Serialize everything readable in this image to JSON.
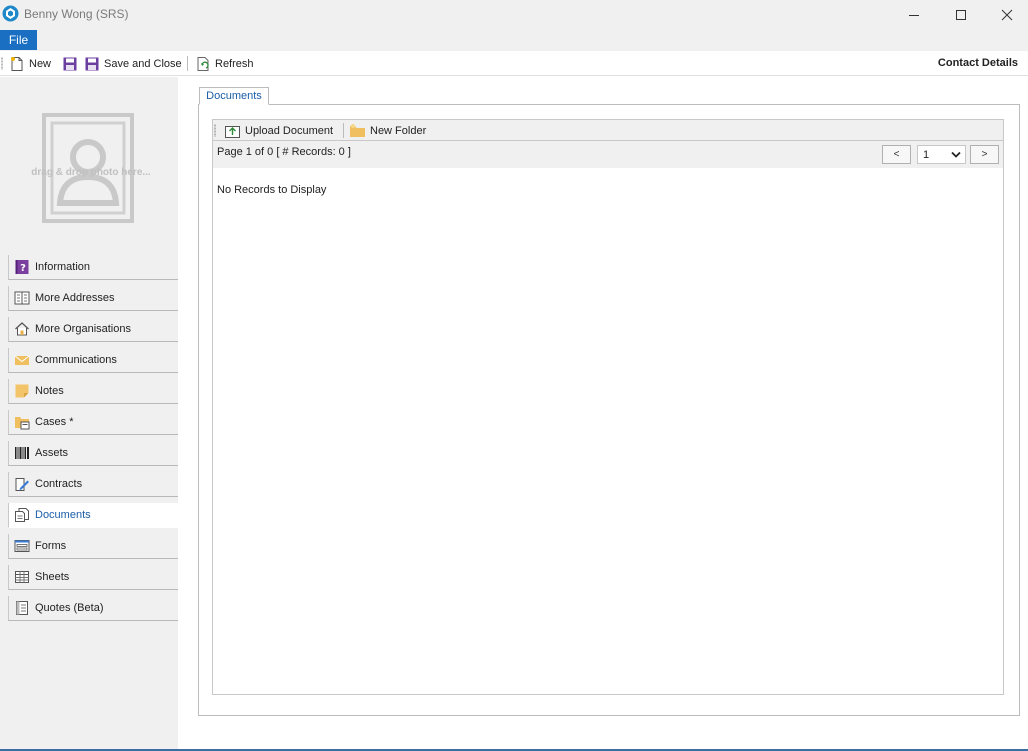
{
  "window": {
    "title": "Benny Wong (SRS)",
    "controls": [
      "minimize-icon",
      "maximize-icon",
      "close-icon"
    ]
  },
  "menu": {
    "file": "File"
  },
  "toolbar": {
    "new_label": "New",
    "save_and_close_label": "Save and Close",
    "refresh_label": "Refresh",
    "section_title": "Contact Details"
  },
  "photo": {
    "hint": "drag & drop photo here..."
  },
  "sidebar": {
    "items": [
      {
        "label": "Information",
        "icon": "question-book-icon"
      },
      {
        "label": "More Addresses",
        "icon": "address-book-icon"
      },
      {
        "label": "More Organisations",
        "icon": "house-icon"
      },
      {
        "label": "Communications",
        "icon": "envelope-icon"
      },
      {
        "label": "Notes",
        "icon": "sticky-note-icon"
      },
      {
        "label": "Cases  *",
        "icon": "case-folder-icon"
      },
      {
        "label": "Assets",
        "icon": "barcode-icon"
      },
      {
        "label": "Contracts",
        "icon": "contract-pen-icon"
      },
      {
        "label": "Documents",
        "icon": "documents-icon"
      },
      {
        "label": "Forms",
        "icon": "form-icon"
      },
      {
        "label": "Sheets",
        "icon": "spreadsheet-icon"
      },
      {
        "label": "Quotes (Beta)",
        "icon": "quote-doc-icon"
      }
    ],
    "active": "Documents"
  },
  "main": {
    "tab_label": "Documents",
    "upload_label": "Upload Document",
    "new_folder_label": "New Folder",
    "page_info": "Page 1 of 0 [ # Records: 0 ]",
    "prev_label": "<",
    "next_label": ">",
    "page_value": "1",
    "empty_message": "No Records to Display"
  },
  "colors": {
    "accent": "#1a6fc2",
    "sidebar_bg": "#f0f0f0",
    "active_text": "#1a5ea8"
  }
}
